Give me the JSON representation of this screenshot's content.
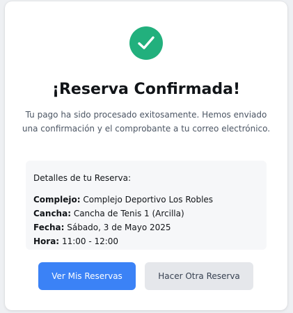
{
  "colors": {
    "success": "#22b07d",
    "primary_button": "#3b82f6",
    "secondary_button": "#e5e7eb"
  },
  "icon": "check-circle-icon",
  "title": "¡Reserva Confirmada!",
  "message": "Tu pago ha sido procesado exitosamente. Hemos enviado una confirmación y el comprobante a tu correo electrónico.",
  "details": {
    "heading": "Detalles de tu Reserva:",
    "rows": [
      {
        "label": "Complejo:",
        "value": "Complejo Deportivo Los Robles"
      },
      {
        "label": "Cancha:",
        "value": "Cancha de Tenis 1 (Arcilla)"
      },
      {
        "label": "Fecha:",
        "value": "Sábado, 3 de Mayo 2025"
      },
      {
        "label": "Hora:",
        "value": "11:00 - 12:00"
      }
    ]
  },
  "buttons": {
    "primary_label": "Ver Mis Reservas",
    "secondary_label": "Hacer Otra Reserva"
  }
}
